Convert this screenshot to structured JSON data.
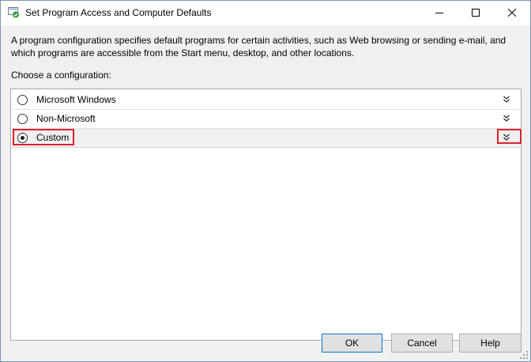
{
  "window": {
    "title": "Set Program Access and Computer Defaults",
    "icon": "program-defaults-icon"
  },
  "titlebar_buttons": {
    "minimize_icon": "minimize-icon",
    "maximize_icon": "maximize-icon",
    "close_icon": "close-icon"
  },
  "description": "A program configuration specifies default programs for certain activities, such as Web browsing or sending e-mail, and which programs are accessible from the Start menu, desktop, and other locations.",
  "choose_label": "Choose a configuration:",
  "configurations": [
    {
      "label": "Microsoft Windows",
      "selected": false,
      "expander_icon": "double-chevron-down-icon"
    },
    {
      "label": "Non-Microsoft",
      "selected": false,
      "expander_icon": "double-chevron-down-icon"
    },
    {
      "label": "Custom",
      "selected": true,
      "expander_icon": "double-chevron-down-icon"
    }
  ],
  "buttons": {
    "ok": "OK",
    "cancel": "Cancel",
    "help": "Help"
  },
  "colors": {
    "highlight": "#d9232e",
    "default_button_border": "#0078d7",
    "shield_green": "#2e9b3a"
  }
}
